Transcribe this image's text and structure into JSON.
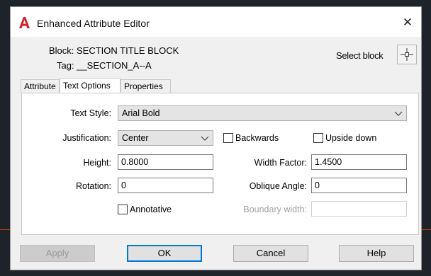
{
  "window": {
    "title": "Enhanced Attribute Editor",
    "close_glyph": "✕",
    "icon_color": "#d2202a",
    "background_line_color": "#c8321e"
  },
  "info": {
    "block": "Block: SECTION TITLE BLOCK",
    "tag": "Tag: __SECTION_A--A",
    "select_block_label": "Select block"
  },
  "tabs": [
    {
      "label": "Attribute",
      "active": false
    },
    {
      "label": "Text Options",
      "active": true
    },
    {
      "label": "Properties",
      "active": false
    }
  ],
  "form": {
    "text_style": {
      "label": "Text Style:",
      "value": "Arial Bold"
    },
    "justification": {
      "label": "Justification:",
      "value": "Center"
    },
    "backwards": {
      "label": "Backwards",
      "checked": false
    },
    "upside_down": {
      "label": "Upside down",
      "checked": false
    },
    "height": {
      "label": "Height:",
      "value": "0.8000"
    },
    "width_factor": {
      "label": "Width Factor:",
      "value": "1.4500"
    },
    "rotation": {
      "label": "Rotation:",
      "value": "0"
    },
    "oblique_angle": {
      "label": "Oblique Angle:",
      "value": "0"
    },
    "annotative": {
      "label": "Annotative",
      "checked": false
    },
    "boundary_width": {
      "label": "Boundary width:",
      "value": "",
      "enabled": false
    }
  },
  "buttons": {
    "apply": "Apply",
    "ok": "OK",
    "cancel": "Cancel",
    "help": "Help"
  },
  "icons": {
    "app": "autocad-a-icon",
    "pick": "crosshair-pick-icon",
    "dropdown": "chevron-down-icon",
    "close": "close-icon"
  }
}
